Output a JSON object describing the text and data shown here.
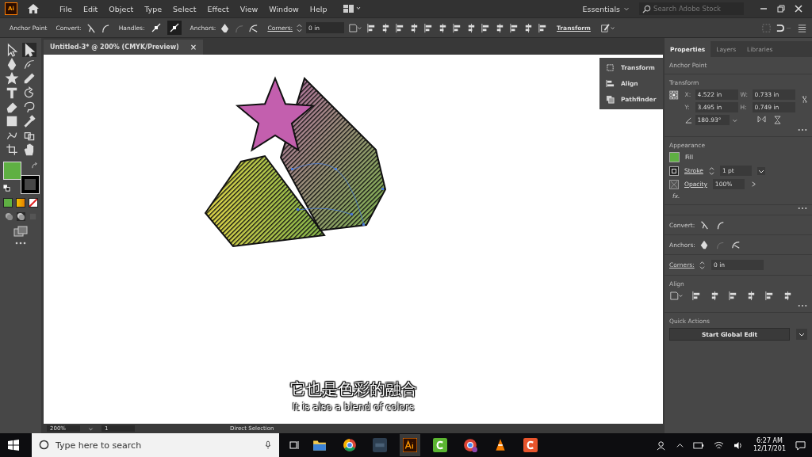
{
  "app_badge": "Ai",
  "menu": [
    "File",
    "Edit",
    "Object",
    "Type",
    "Select",
    "Effect",
    "View",
    "Window",
    "Help"
  ],
  "workspace": "Essentials",
  "stock_search": {
    "placeholder": "Search Adobe Stock"
  },
  "control_bar": {
    "context": "Anchor Point",
    "convert_label": "Convert:",
    "handles_label": "Handles:",
    "handles": [
      {
        "selected": false
      },
      {
        "selected": true
      }
    ],
    "anchors_label": "Anchors:",
    "corners_label": "Corners:",
    "corners_value": "0 in",
    "transform_link": "Transform"
  },
  "document_tab": {
    "title": "Untitled-3* @ 200% (CMYK/Preview)",
    "close": "×"
  },
  "tools": [
    {
      "kind": "selection",
      "selected": false
    },
    {
      "kind": "direct-selection",
      "selected": true
    },
    {
      "kind": "pen",
      "selected": false
    },
    {
      "kind": "curvature",
      "selected": false
    },
    {
      "kind": "star",
      "selected": false
    },
    {
      "kind": "pencil",
      "selected": false
    },
    {
      "kind": "type",
      "selected": false
    },
    {
      "kind": "rotate",
      "selected": false
    },
    {
      "kind": "eraser",
      "selected": false
    },
    {
      "kind": "lasso",
      "selected": false
    },
    {
      "kind": "gradient",
      "selected": false
    },
    {
      "kind": "eyedropper",
      "selected": false
    },
    {
      "kind": "puppet",
      "selected": false
    },
    {
      "kind": "shape-builder",
      "selected": false
    },
    {
      "kind": "artboard",
      "selected": false
    },
    {
      "kind": "hand",
      "selected": false
    }
  ],
  "floating_panel": [
    "Transform",
    "Align",
    "Pathfinder"
  ],
  "panel_tabs": [
    {
      "label": "Properties",
      "selected": true
    },
    {
      "label": "Layers",
      "selected": false
    },
    {
      "label": "Libraries",
      "selected": false
    }
  ],
  "properties": {
    "selection": "Anchor Point",
    "transform": {
      "title": "Transform",
      "x_label": "X:",
      "x": "4.522 in",
      "w_label": "W:",
      "w": "0.733 in",
      "y_label": "Y:",
      "y": "3.495 in",
      "h_label": "H:",
      "h": "0.749 in",
      "angle": "180.93°"
    },
    "appearance": {
      "title": "Appearance",
      "fill": "Fill",
      "stroke": "Stroke",
      "stroke_weight": "1 pt",
      "opacity": "Opacity",
      "opacity_value": "100%",
      "fx": "fx."
    },
    "convert_label": "Convert:",
    "anchors_label": "Anchors:",
    "corners_label": "Corners:",
    "corners_value": "0 in",
    "align_title": "Align",
    "quick_actions": "Quick Actions",
    "global_edit": "Start Global Edit"
  },
  "status_bar": {
    "zoom": "200%",
    "artboard": "1",
    "tool": "Direct Selection"
  },
  "subtitles": [
    "它也是色彩的融合",
    "It is also a blend of colors"
  ],
  "taskbar": {
    "search_placeholder": "Type here to search",
    "time": "6:27 AM",
    "date": "12/17/201"
  }
}
